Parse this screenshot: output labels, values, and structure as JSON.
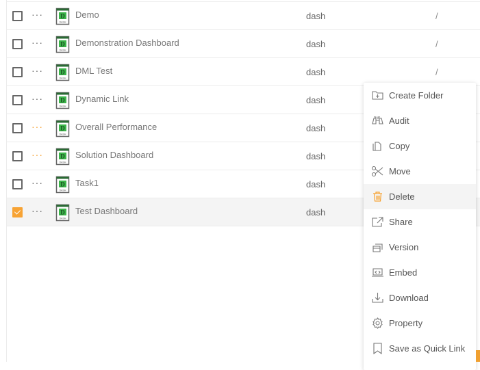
{
  "rows": [
    {
      "name": "Demo",
      "type": "dash",
      "path": "/",
      "checked": false,
      "more_color": "gray"
    },
    {
      "name": "Demonstration Dashboard",
      "type": "dash",
      "path": "/",
      "checked": false,
      "more_color": "gray"
    },
    {
      "name": "DML Test",
      "type": "dash",
      "path": "/",
      "checked": false,
      "more_color": "gray"
    },
    {
      "name": "Dynamic Link",
      "type": "dash",
      "path": "",
      "checked": false,
      "more_color": "gray"
    },
    {
      "name": "Overall Performance",
      "type": "dash",
      "path": "",
      "checked": false,
      "more_color": "orange"
    },
    {
      "name": "Solution Dashboard",
      "type": "dash",
      "path": "",
      "checked": false,
      "more_color": "orange"
    },
    {
      "name": "Task1",
      "type": "dash",
      "path": "",
      "checked": false,
      "more_color": "gray"
    },
    {
      "name": "Test Dashboard",
      "type": "dash",
      "path": "",
      "checked": true,
      "more_color": "gray"
    }
  ],
  "more_label": "···",
  "context_menu": {
    "items": [
      {
        "label": "Create Folder",
        "icon": "folder-plus-icon"
      },
      {
        "label": "Audit",
        "icon": "binoculars-icon"
      },
      {
        "label": "Copy",
        "icon": "copy-icon"
      },
      {
        "label": "Move",
        "icon": "scissors-icon"
      },
      {
        "label": "Delete",
        "icon": "trash-icon",
        "highlighted": true
      },
      {
        "label": "Share",
        "icon": "share-icon"
      },
      {
        "label": "Version",
        "icon": "version-icon"
      },
      {
        "label": "Embed",
        "icon": "embed-icon"
      },
      {
        "label": "Download",
        "icon": "download-icon"
      },
      {
        "label": "Property",
        "icon": "gear-icon"
      },
      {
        "label": "Save as Quick Link",
        "icon": "bookmark-icon"
      }
    ]
  },
  "colors": {
    "accent": "#f7a334",
    "file_icon_green": "#2e9d3a"
  }
}
